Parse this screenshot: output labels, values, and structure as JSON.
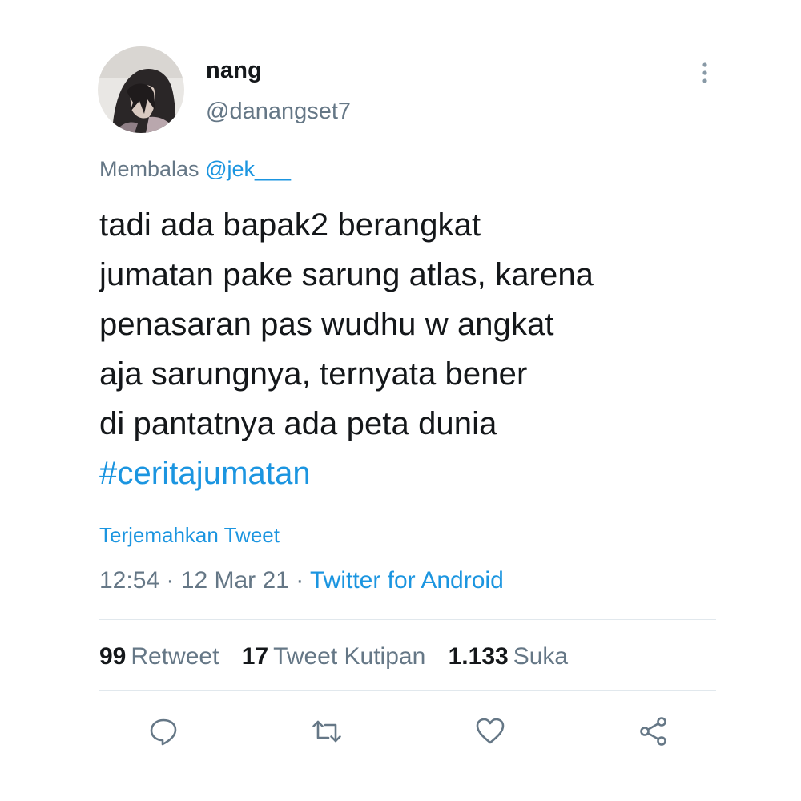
{
  "author": {
    "name": "nang",
    "handle": "@danangset7",
    "avatar_icon": "profile-avatar"
  },
  "more_menu_icon": "more-vertical-icon",
  "reply": {
    "prefix": "Membalas",
    "mention": "@jek___"
  },
  "tweet": {
    "lines": [
      "tadi ada bapak2 berangkat",
      "jumatan pake sarung atlas, karena",
      "penasaran pas wudhu w angkat",
      "aja sarungnya, ternyata bener",
      "di pantatnya ada peta dunia"
    ],
    "hashtag": "#ceritajumatan"
  },
  "translate_label": "Terjemahkan Tweet",
  "meta": {
    "time": "12:54",
    "date": "12 Mar 21",
    "separator": "·",
    "source": "Twitter for Android"
  },
  "stats": {
    "retweets": {
      "count": "99",
      "label": "Retweet"
    },
    "quotes": {
      "count": "17",
      "label": "Tweet Kutipan"
    },
    "likes": {
      "count": "1.133",
      "label": "Suka"
    }
  },
  "actions": [
    {
      "name": "reply",
      "icon": "comment-icon"
    },
    {
      "name": "retweet",
      "icon": "retweet-icon"
    },
    {
      "name": "like",
      "icon": "heart-icon"
    },
    {
      "name": "share",
      "icon": "share-icon"
    }
  ],
  "colors": {
    "accent": "#1b95e0",
    "muted": "#657786",
    "text": "#14171a",
    "divider": "#e1e8ed"
  }
}
